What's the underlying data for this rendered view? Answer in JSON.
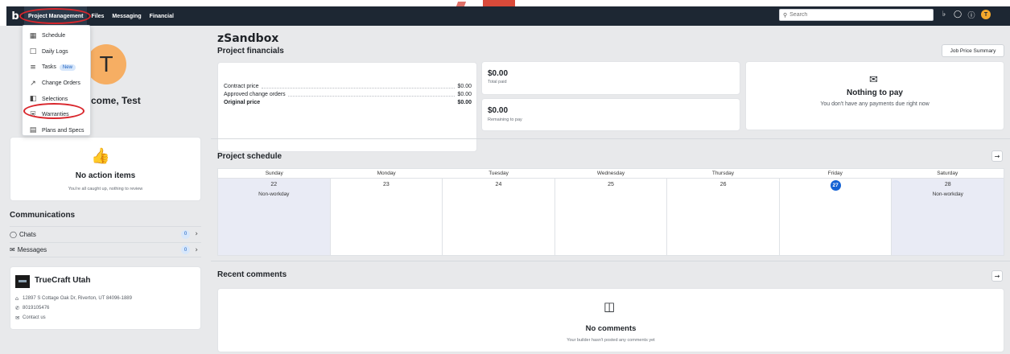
{
  "nav": {
    "brand": "b",
    "links": [
      "Project Management",
      "Files",
      "Messaging",
      "Financial"
    ],
    "search_placeholder": "Search",
    "user_initial": "T"
  },
  "dropdown": {
    "items": [
      {
        "label": "Schedule",
        "icon": "calendar-icon"
      },
      {
        "label": "Daily Logs",
        "icon": "daily-log-icon"
      },
      {
        "label": "Tasks",
        "icon": "tasks-icon",
        "badge": "New"
      },
      {
        "label": "Change Orders",
        "icon": "change-order-icon"
      },
      {
        "label": "Selections",
        "icon": "selections-icon"
      },
      {
        "label": "Warranties",
        "icon": "shield-icon"
      },
      {
        "label": "Plans and Specs",
        "icon": "plans-icon"
      }
    ]
  },
  "left": {
    "avatar_initial": "T",
    "welcome": "come, Test",
    "action_title": "No action items",
    "action_sub": "You're all caught up, nothing to review",
    "comm_title": "Communications",
    "chats_label": "Chats",
    "chats_count": "0",
    "messages_label": "Messages",
    "messages_count": "0",
    "company_name": "TrueCraft Utah",
    "address": "12897 S Cottage Oak Dr, Riverton, UT 84096-1889",
    "phone": "8019105476",
    "contact": "Contact us"
  },
  "main": {
    "project_name": "zSandbox",
    "fin_title": "Project financials",
    "job_price_btn": "Job Price Summary",
    "contract_label": "Contract price",
    "contract_value": "$0.00",
    "change_label": "Approved change orders",
    "change_value": "$0.00",
    "original_label": "Original price",
    "original_value": "$0.00",
    "total_paid_amount": "$0.00",
    "total_paid_label": "Total paid",
    "remaining_amount": "$0.00",
    "remaining_label": "Remaining to pay",
    "pay_title": "Nothing to pay",
    "pay_sub": "You don't have any payments due right now",
    "schedule_title": "Project schedule",
    "days": [
      "Sunday",
      "Monday",
      "Tuesday",
      "Wednesday",
      "Thursday",
      "Friday",
      "Saturday"
    ],
    "dates": [
      "22",
      "23",
      "24",
      "25",
      "26",
      "27",
      "28"
    ],
    "nonworkday": "Non-workday",
    "comments_title": "Recent comments",
    "no_comments": "No comments",
    "no_comments_sub": "Your builder hasn't posted any comments yet"
  },
  "colors": {
    "navbar": "#1d2733",
    "accent": "#1462d4",
    "highlight": "#d9262c",
    "avatar": "#f6ae63"
  }
}
